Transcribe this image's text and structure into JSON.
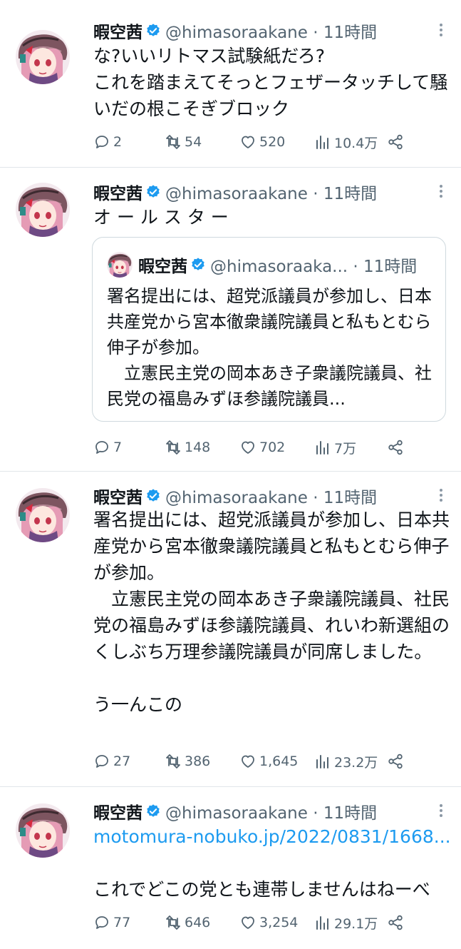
{
  "tweets": [
    {
      "name": "暇空茜",
      "handle": "@himasoraakane · 11時間",
      "text": "な?いいリトマス試験紙だろ?\nこれを踏まえてそっとフェザータッチして騒いだの根こそぎブロック",
      "replies": "2",
      "retweets": "54",
      "likes": "520",
      "views": "10.4万"
    },
    {
      "name": "暇空茜",
      "handle": "@himasoraakane · 11時間",
      "text": "オ ー ル ス タ ー",
      "quote": {
        "name": "暇空茜",
        "handle": "@himasoraaka... · 11時間",
        "text": "署名提出には、超党派議員が参加し、日本共産党から宮本徹衆議院議員と私もとむら伸子が参加。\n　立憲民主党の岡本あき子衆議院議員、社民党の福島みずほ参議院議員..."
      },
      "replies": "7",
      "retweets": "148",
      "likes": "702",
      "views": "7万"
    },
    {
      "name": "暇空茜",
      "handle": "@himasoraakane · 11時間",
      "text": "署名提出には、超党派議員が参加し、日本共産党から宮本徹衆議院議員と私もとむら伸子が参加。\n　立憲民主党の岡本あき子衆議院議員、社民党の福島みずほ参議院議員、れいわ新選組のくしぶち万理参議院議員が同席しました。\n\nう一んこの",
      "replies": "27",
      "retweets": "386",
      "likes": "1,645",
      "views": "23.2万"
    },
    {
      "name": "暇空茜",
      "handle": "@himasoraakane · 11時間",
      "link": "motomura-nobuko.jp/2022/0831/1668...",
      "text": "これでどこの党とも連帯しませんはねーべ",
      "replies": "77",
      "retweets": "646",
      "likes": "3,254",
      "views": "29.1万"
    }
  ],
  "colors": {
    "text": "#0f1419",
    "secondary": "#536471",
    "link": "#1d9bf0",
    "verified": "#1d9bf0",
    "border": "#e1e6ea"
  }
}
